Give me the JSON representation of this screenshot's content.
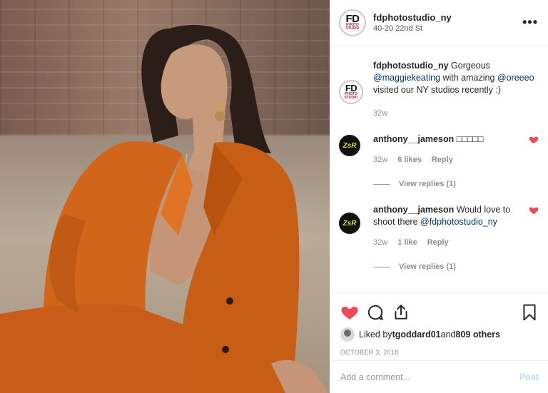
{
  "post": {
    "author": {
      "username": "fdphotostudio_ny",
      "location": "40-20 22nd St",
      "avatar_text": "FD",
      "avatar_subtext": "PHOTO STUDIO"
    },
    "more_label": "•••",
    "caption": {
      "username": "fdphotostudio_ny",
      "text_1": " Gorgeous ",
      "mention_1": "@maggiekeating",
      "text_2": " with amazing ",
      "mention_2": "@oreeeo",
      "text_3": " visited our NY studios recently :)",
      "time": "32w"
    },
    "comments": [
      {
        "avatar_text": "ZsR",
        "username": "anthony__jameson",
        "text": " □□□□□",
        "mention": "",
        "time": "32w",
        "likes": "6 likes",
        "reply_label": "Reply",
        "view_replies": "View replies (1)",
        "liked": true
      },
      {
        "avatar_text": "ZsR",
        "username": "anthony__jameson",
        "text": " Would love to shoot there ",
        "mention": "@fdphotostudio_ny",
        "time": "32w",
        "likes": "1 like",
        "reply_label": "Reply",
        "view_replies": "View replies (1)",
        "liked": true
      }
    ],
    "liked_by": {
      "prefix": "Liked by ",
      "user": "tgoddard01",
      "middle": " and ",
      "count": "809 others"
    },
    "date": "OCTOBER 3, 2018",
    "add_comment_placeholder": "Add a comment...",
    "post_button": "Post",
    "colors": {
      "like_red": "#ed4956",
      "mention_blue": "#00376b",
      "post_disabled": "#b2dffc"
    }
  }
}
